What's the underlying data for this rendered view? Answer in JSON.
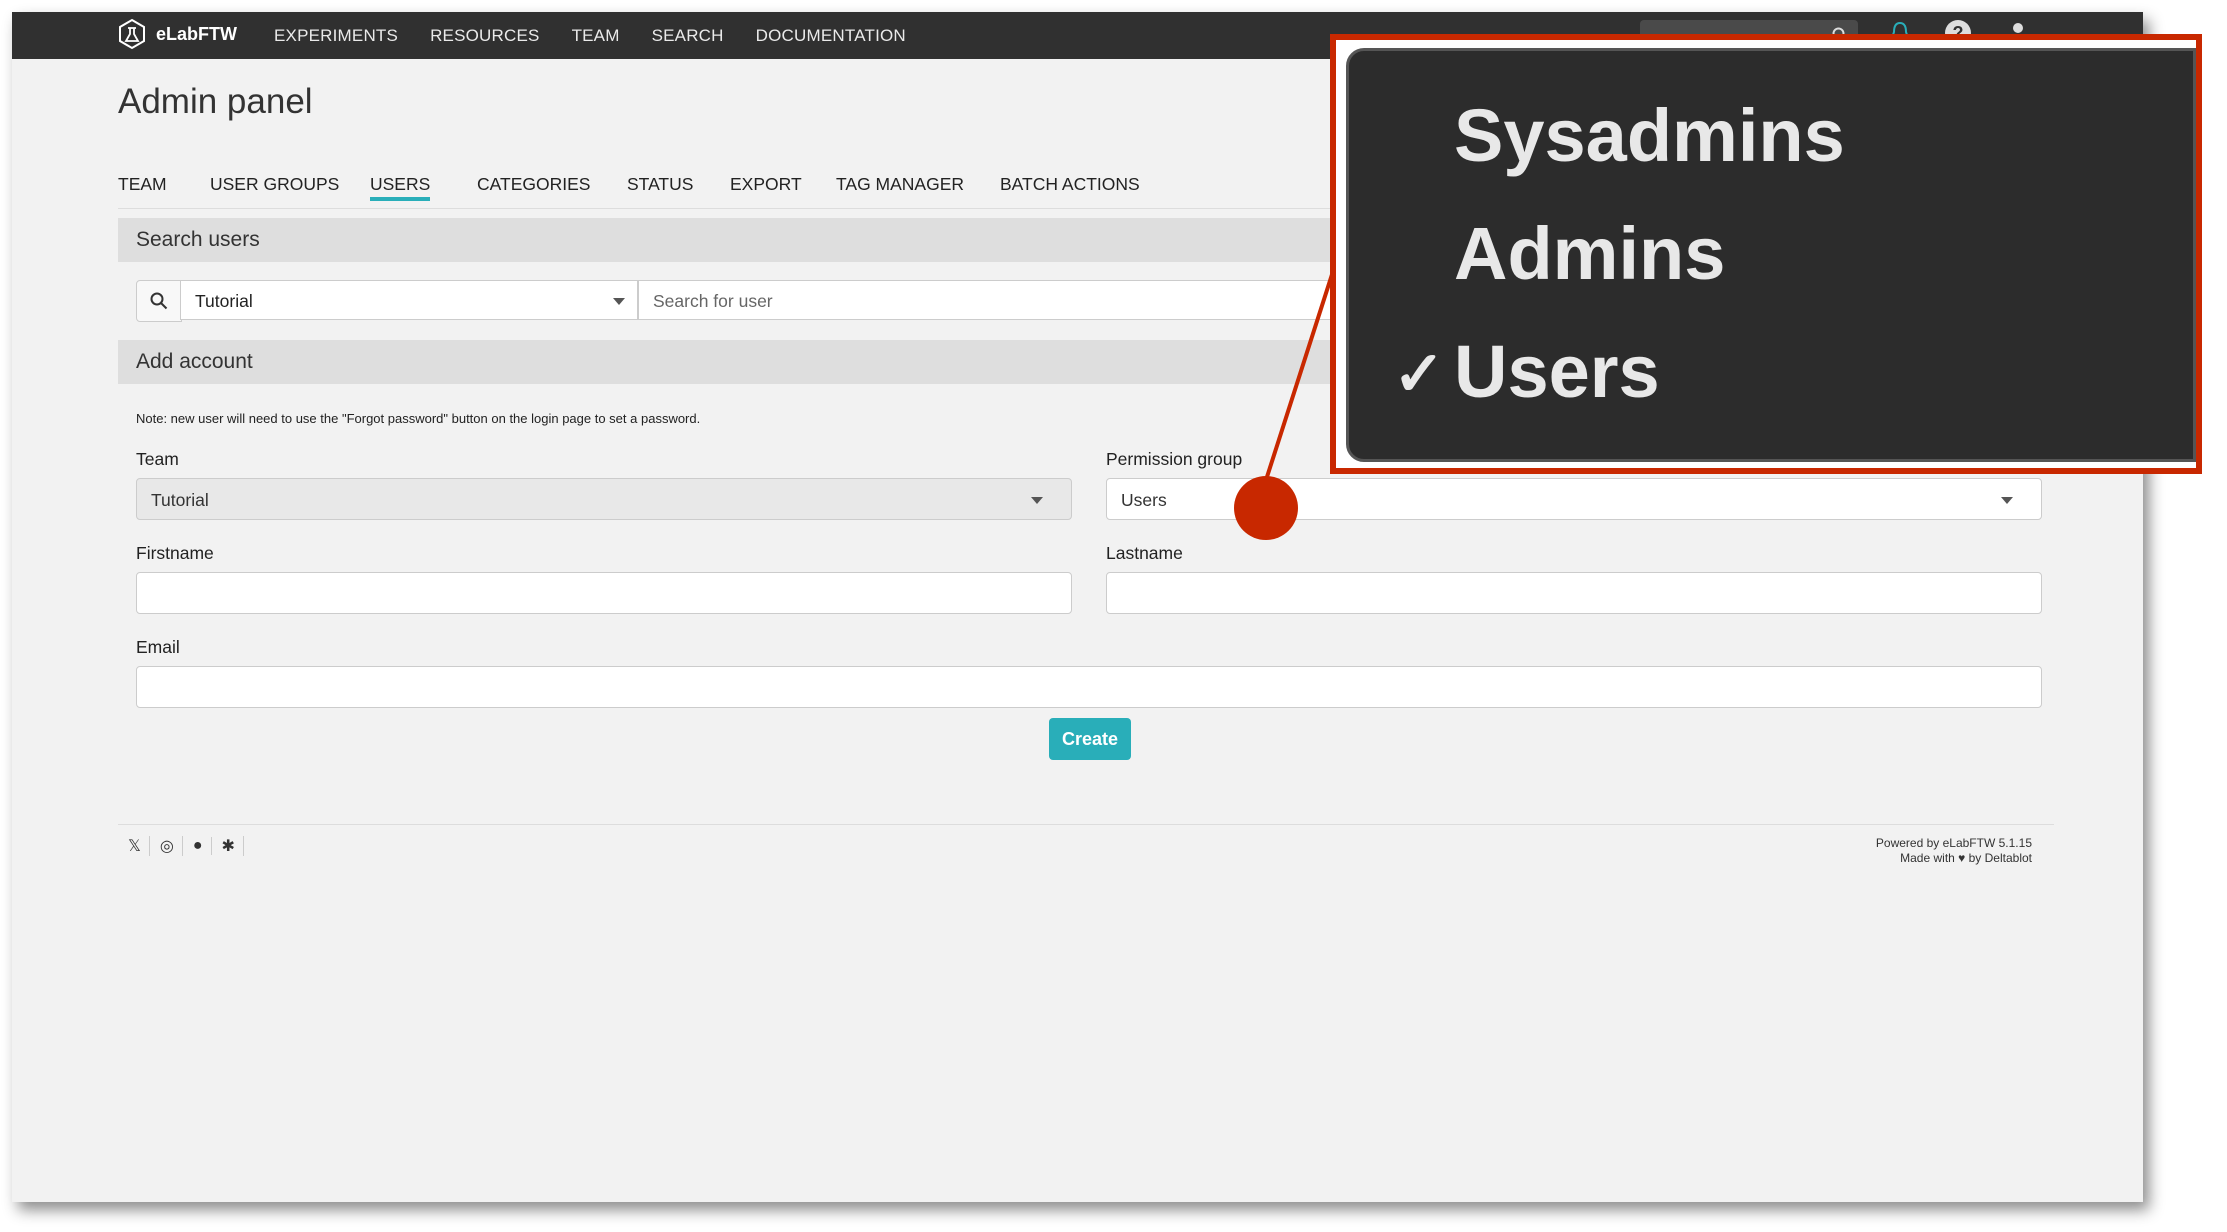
{
  "topnav": {
    "brand": "eLabFTW",
    "links": [
      "EXPERIMENTS",
      "RESOURCES",
      "TEAM",
      "SEARCH",
      "DOCUMENTATION"
    ],
    "help_symbol": "?"
  },
  "page_title": "Admin panel",
  "tabs": [
    {
      "label": "TEAM",
      "active": false
    },
    {
      "label": "USER GROUPS",
      "active": false
    },
    {
      "label": "USERS",
      "active": true
    },
    {
      "label": "CATEGORIES",
      "active": false
    },
    {
      "label": "STATUS",
      "active": false
    },
    {
      "label": "EXPORT",
      "active": false
    },
    {
      "label": "TAG MANAGER",
      "active": false
    },
    {
      "label": "BATCH ACTIONS",
      "active": false
    }
  ],
  "search_users": {
    "heading": "Search users",
    "team_value": "Tutorial",
    "search_placeholder": "Search for user"
  },
  "add_account": {
    "heading": "Add account",
    "note": "Note: new user will need to use the \"Forgot password\" button on the login page to set a password.",
    "team_label": "Team",
    "team_value": "Tutorial",
    "permission_label": "Permission group",
    "permission_value": "Users",
    "firstname_label": "Firstname",
    "lastname_label": "Lastname",
    "email_label": "Email",
    "create_label": "Create"
  },
  "footer": {
    "powered_by": "Powered by eLabFTW 5.1.15",
    "made_with": "Made with ♥ by Deltablot"
  },
  "callout": {
    "options": [
      "Sysadmins",
      "Admins",
      "Users"
    ],
    "selected": "Users",
    "check_symbol": "✓"
  },
  "colors": {
    "accent": "#29aeb9",
    "navbar": "#303030",
    "callout": "#c82800"
  }
}
